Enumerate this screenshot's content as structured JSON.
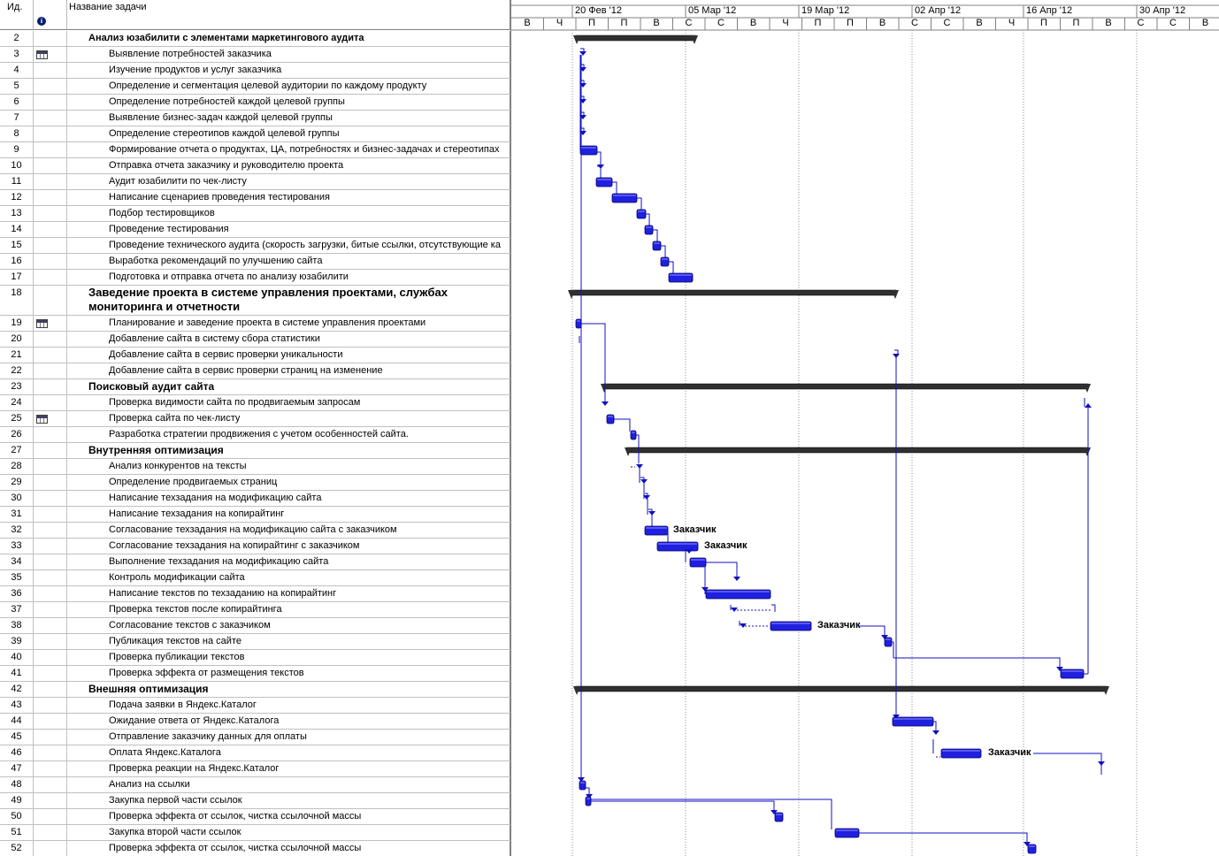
{
  "header": {
    "id_label": "Ид.",
    "name_label": "Название задачи",
    "info_icon": "info-icon"
  },
  "timescale": {
    "weeks": [
      "20 Фев '12",
      "05 Мар '12",
      "19 Мар '12",
      "02 Апр '12",
      "16 Апр '12",
      "30 Апр '12"
    ],
    "days": [
      "В",
      "Ч",
      "П",
      "П",
      "В",
      "С",
      "С",
      "В",
      "Ч",
      "П",
      "П",
      "В",
      "С",
      "С",
      "В",
      "Ч",
      "П",
      "П",
      "В",
      "С",
      "С",
      "В"
    ]
  },
  "colors": {
    "bar": "#2020e0",
    "summary": "#303030",
    "link": "#1010c0",
    "grid": "#c0c0c0"
  },
  "tasks": [
    {
      "id": "2",
      "name": "Анализ юзабилити с элементами маркетингового аудита",
      "level": 1
    },
    {
      "id": "3",
      "name": "Выявление потребностей заказчика",
      "level": 2,
      "icon": "calendar-icon"
    },
    {
      "id": "4",
      "name": "Изучение продуктов и услуг заказчика",
      "level": 2
    },
    {
      "id": "5",
      "name": "Определение и сегментация целевой аудитории по каждому продукту",
      "level": 2
    },
    {
      "id": "6",
      "name": "Определение потребностей каждой целевой группы",
      "level": 2
    },
    {
      "id": "7",
      "name": "Выявление бизнес-задач каждой целевой группы",
      "level": 2
    },
    {
      "id": "8",
      "name": "Определение стереотипов каждой целевой группы",
      "level": 2
    },
    {
      "id": "9",
      "name": "Формирование отчета о продуктах, ЦА, потребностях и бизнес-задачах и стереотипах",
      "level": 2
    },
    {
      "id": "10",
      "name": "Отправка отчета заказчику и руководителю проекта",
      "level": 2
    },
    {
      "id": "11",
      "name": "Аудит юзабилити по чек-листу",
      "level": 2
    },
    {
      "id": "12",
      "name": "Написание сценариев проведения тестирования",
      "level": 2
    },
    {
      "id": "13",
      "name": "Подбор тестировщиков",
      "level": 2
    },
    {
      "id": "14",
      "name": "Проведение тестирования",
      "level": 2
    },
    {
      "id": "15",
      "name": "Проведение технического аудита (скорость загрузки, битые ссылки, отсутствующие ка",
      "level": 2
    },
    {
      "id": "16",
      "name": "Выработка рекомендаций по улучшению сайта",
      "level": 2
    },
    {
      "id": "17",
      "name": "Подготовка и отправка отчета по анализу юзабилити",
      "level": 2
    },
    {
      "id": "18",
      "name": "Заведение проекта в системе управления проектами, службах мониторинга и отчетности",
      "level": 1,
      "tall": true
    },
    {
      "id": "19",
      "name": "Планирование и заведение проекта в системе управления проектами",
      "level": 2,
      "icon": "calendar-icon"
    },
    {
      "id": "20",
      "name": "Добавление сайта в систему сбора статистики",
      "level": 2
    },
    {
      "id": "21",
      "name": "Добавление сайта в сервис проверки уникальности",
      "level": 2
    },
    {
      "id": "22",
      "name": "Добавление сайта в сервис проверки страниц на изменение",
      "level": 2
    },
    {
      "id": "23",
      "name": "Поисковый аудит сайта",
      "level": 1,
      "big": true
    },
    {
      "id": "24",
      "name": "Проверка видимости сайта по продвигаемым запросам",
      "level": 2
    },
    {
      "id": "25",
      "name": "Проверка сайта по чек-листу",
      "level": 2,
      "icon": "calendar-icon"
    },
    {
      "id": "26",
      "name": "Разработка стратегии продвижения с учетом особенностей сайта.",
      "level": 2
    },
    {
      "id": "27",
      "name": "Внутренняя оптимизация",
      "level": 1,
      "big": true
    },
    {
      "id": "28",
      "name": "Анализ конкурентов на тексты",
      "level": 2
    },
    {
      "id": "29",
      "name": "Определение продвигаемых страниц",
      "level": 2
    },
    {
      "id": "30",
      "name": "Написание техзадания на модификацию сайта",
      "level": 2
    },
    {
      "id": "31",
      "name": "Написание техзадания на копирайтинг",
      "level": 2
    },
    {
      "id": "32",
      "name": "Согласование техзадания на модификацию сайта с заказчиком",
      "level": 2
    },
    {
      "id": "33",
      "name": "Согласование техзадания на копирайтинг с заказчиком",
      "level": 2
    },
    {
      "id": "34",
      "name": "Выполнение техзадания на модификацию сайта",
      "level": 2
    },
    {
      "id": "35",
      "name": "Контроль модификации сайта",
      "level": 2
    },
    {
      "id": "36",
      "name": "Написание текстов по техзаданию на копирайтинг",
      "level": 2
    },
    {
      "id": "37",
      "name": "Проверка текстов после копирайтинга",
      "level": 2
    },
    {
      "id": "38",
      "name": "Согласование текстов с заказчиком",
      "level": 2
    },
    {
      "id": "39",
      "name": "Публикация текстов на сайте",
      "level": 2
    },
    {
      "id": "40",
      "name": "Проверка публикации текстов",
      "level": 2
    },
    {
      "id": "41",
      "name": "Проверка эффекта от размещения текстов",
      "level": 2
    },
    {
      "id": "42",
      "name": "Внешняя оптимизация",
      "level": 1,
      "big": true
    },
    {
      "id": "43",
      "name": "Подача заявки в Яндекс.Каталог",
      "level": 2
    },
    {
      "id": "44",
      "name": "Ожидание ответа от Яндекс.Каталога",
      "level": 2
    },
    {
      "id": "45",
      "name": "Отправление заказчику данных для оплаты",
      "level": 2
    },
    {
      "id": "46",
      "name": "Оплата Яндекс.Каталога",
      "level": 2
    },
    {
      "id": "47",
      "name": "Проверка реакции на Яндекс.Каталог",
      "level": 2
    },
    {
      "id": "48",
      "name": "Анализ на ссылки",
      "level": 2
    },
    {
      "id": "49",
      "name": "Закупка первой части ссылок",
      "level": 2
    },
    {
      "id": "50",
      "name": "Проверка эффекта от ссылок, чистка ссылочной массы",
      "level": 2
    },
    {
      "id": "51",
      "name": "Закупка второй части ссылок",
      "level": 2
    },
    {
      "id": "52",
      "name": "Проверка эффекта от ссылок, чистка ссылочной массы",
      "level": 2
    }
  ],
  "bar_labels": {
    "t32": "Заказчик",
    "t33": "Заказчик",
    "t38": "Заказчик",
    "t46": "Заказчик"
  }
}
